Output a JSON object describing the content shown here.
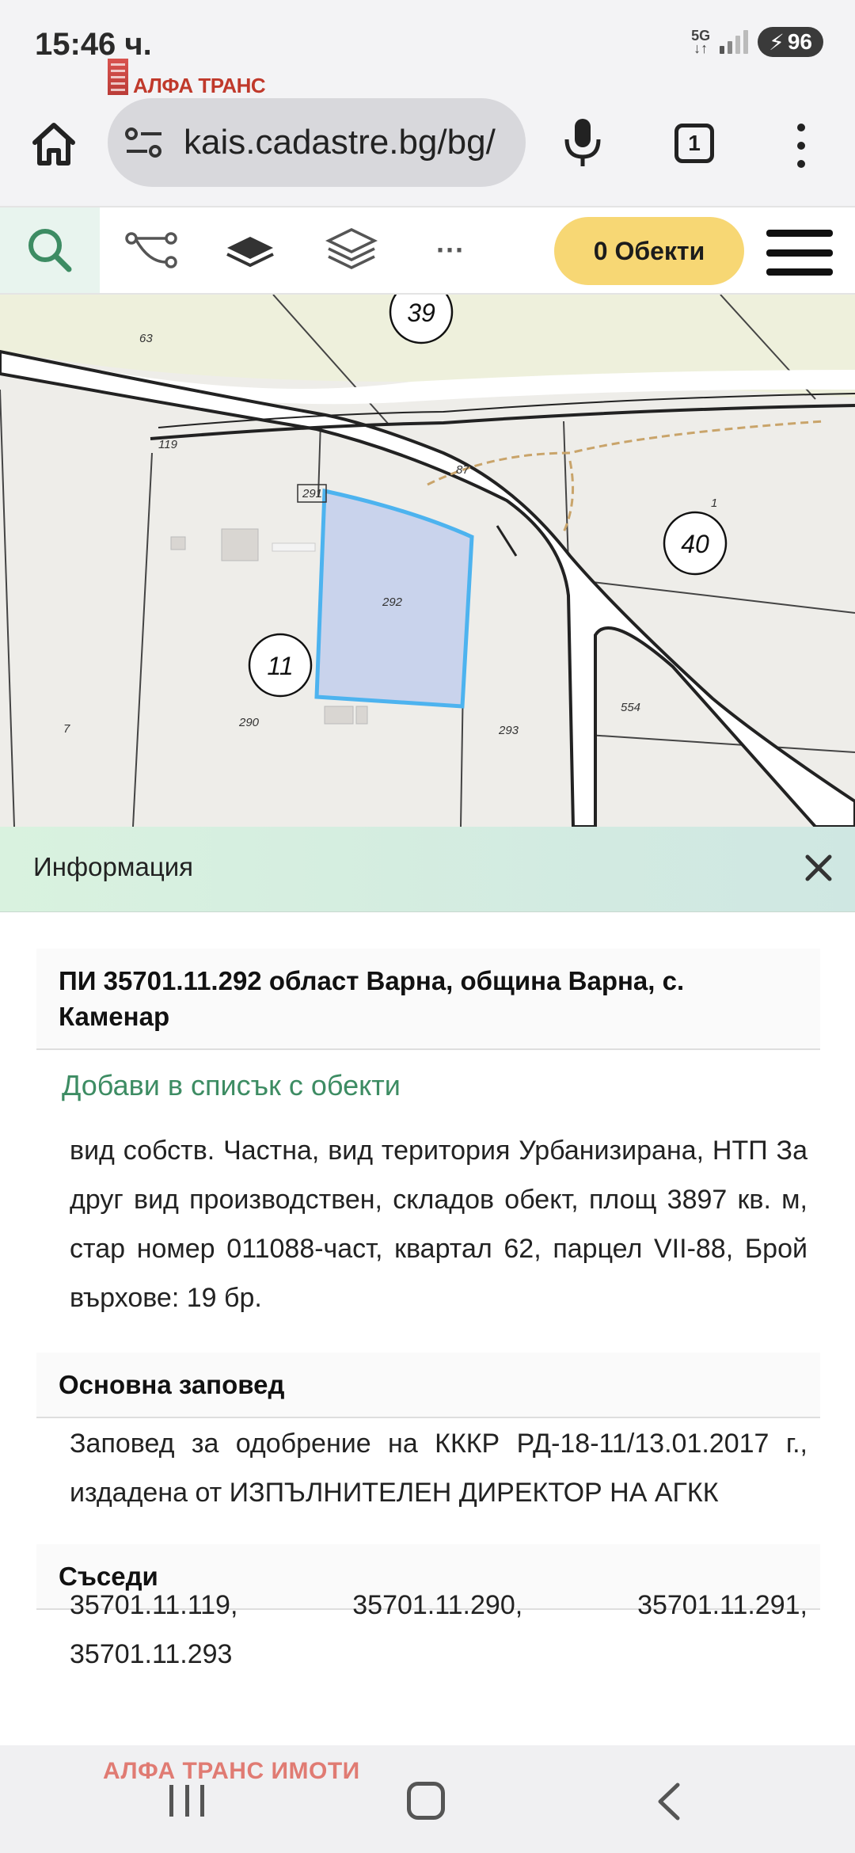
{
  "status_bar": {
    "time": "15:46 ч.",
    "network_top": "5G",
    "network_bottom": "↓↑",
    "battery": "96"
  },
  "watermark": {
    "logo_text": "АЛФА ТРАНС",
    "bottom_text": "АЛФА ТРАНС ИМОТИ"
  },
  "browser": {
    "url": "kais.cadastre.bg/bg/",
    "tab_count": "1"
  },
  "toolbar": {
    "objects_label": "0 Обекти",
    "more_label": "···"
  },
  "map": {
    "parcel_labels": {
      "p63": "63",
      "p119": "119",
      "p87": "87",
      "p291": "291",
      "p292": "292",
      "p290": "290",
      "p293": "293",
      "p554": "554",
      "p7": "7",
      "p1": "1"
    },
    "quarter_labels": {
      "q39": "39",
      "q40": "40",
      "q11": "11"
    }
  },
  "info": {
    "title": "Информация",
    "parcel_heading": "ПИ 35701.11.292 област Варна, община Варна, с. Каменар",
    "add_link": "Добави в списък с обекти",
    "description": "вид собств. Частна, вид територия Урбанизирана, НТП За друг вид производствен, складов обект, площ 3897 кв. м, стар номер 011088-част, квартал 62, парцел VII-88, Брой върхове: 19 бр.",
    "order_heading": "Основна заповед",
    "order_text": "Заповед за одобрение на КККР РД-18-11/13.01.2017 г., издадена от ИЗПЪЛНИТЕЛЕН ДИРЕКТОР НА АГКК",
    "neighbours_heading": "Съседи",
    "neighbours": [
      "35701.11.119,",
      "35701.11.290,",
      "35701.11.291,",
      "35701.11.293"
    ]
  },
  "colors": {
    "accent_green": "#3d8c63",
    "objects_button": "#f7d774",
    "parcel_fill": "#c9d3ec",
    "parcel_stroke": "#4db3ef"
  }
}
